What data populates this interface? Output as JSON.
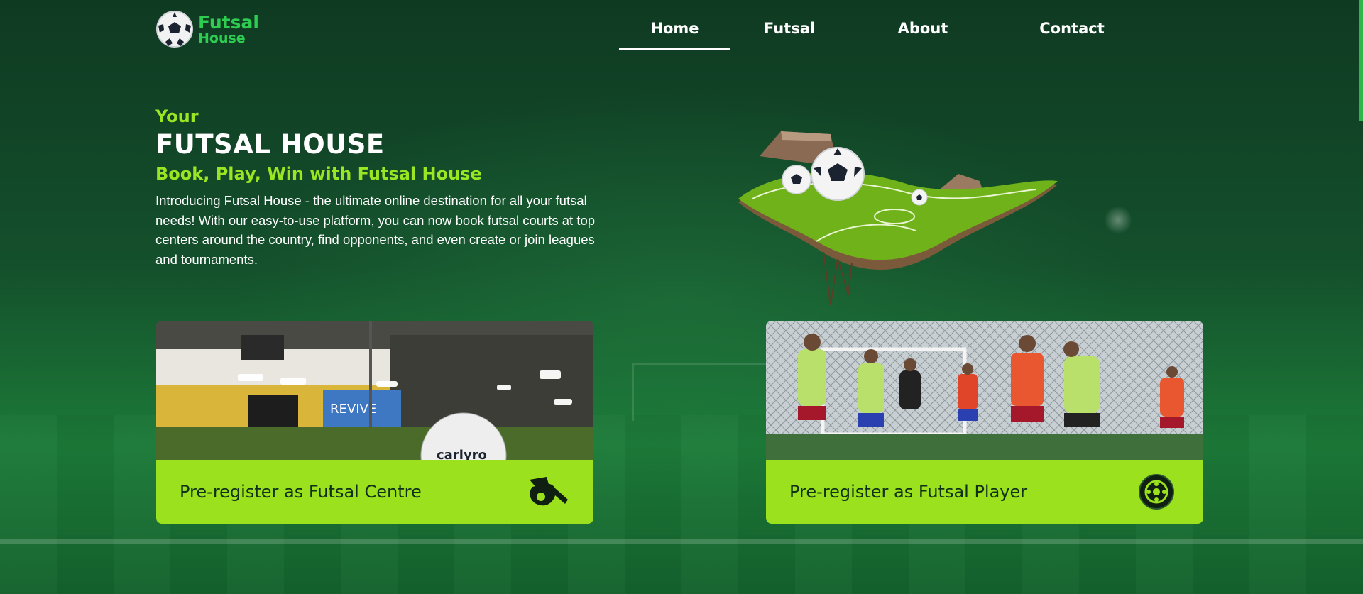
{
  "brand": {
    "line1": "Futsal",
    "line2": "House"
  },
  "nav": {
    "items": [
      {
        "label": "Home",
        "active": true
      },
      {
        "label": "Futsal"
      },
      {
        "label": "About"
      },
      {
        "label": "Contact"
      }
    ]
  },
  "hero": {
    "eyebrow": "Your",
    "title": "FUTSAL HOUSE",
    "tagline": "Book, Play, Win with Futsal House",
    "description": "Introducing Futsal House - the ultimate online destination for all your futsal needs! With our easy-to-use platform, you can now book futsal courts at top centers around the country, find opponents, and even create or join leagues and tournaments."
  },
  "cards": [
    {
      "label": "Pre-register as Futsal Centre",
      "icon": "whistle-icon"
    },
    {
      "label": "Pre-register as Futsal Player",
      "icon": "player-badge-icon"
    }
  ],
  "photo_text": {
    "ball_brand": "carlyro",
    "banner": "REVIVE"
  },
  "colors": {
    "accent": "#9be11d",
    "brand": "#2ecc50",
    "background": "#14502c"
  }
}
